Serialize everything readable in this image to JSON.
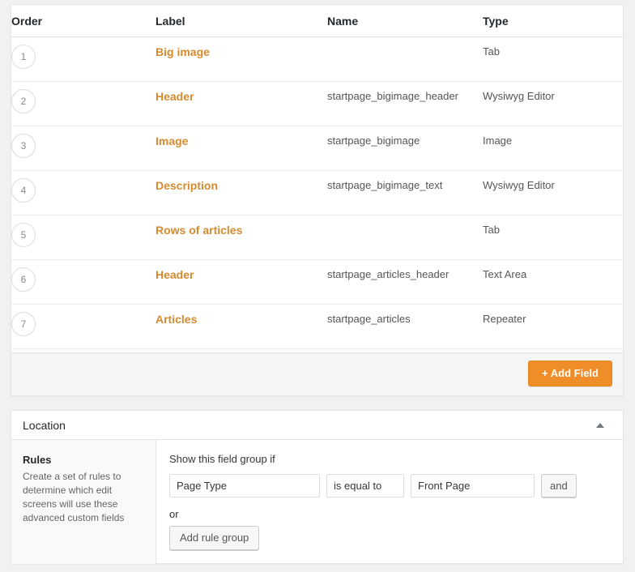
{
  "fields_table": {
    "columns": [
      "Order",
      "Label",
      "Name",
      "Type"
    ],
    "rows": [
      {
        "order": "1",
        "label": "Big image",
        "name": "",
        "type": "Tab",
        "group_start": false
      },
      {
        "order": "2",
        "label": "Header",
        "name": "startpage_bigimage_header",
        "type": "Wysiwyg Editor",
        "group_start": false
      },
      {
        "order": "3",
        "label": "Image",
        "name": "startpage_bigimage",
        "type": "Image",
        "group_start": false
      },
      {
        "order": "4",
        "label": "Description",
        "name": "startpage_bigimage_text",
        "type": "Wysiwyg Editor",
        "group_start": false
      },
      {
        "order": "5",
        "label": "Rows of articles",
        "name": "",
        "type": "Tab",
        "group_start": true
      },
      {
        "order": "6",
        "label": "Header",
        "name": "startpage_articles_header",
        "type": "Text Area",
        "group_start": false
      },
      {
        "order": "7",
        "label": "Articles",
        "name": "startpage_articles",
        "type": "Repeater",
        "group_start": false
      }
    ],
    "footer": {
      "add_field_label": "+ Add Field"
    }
  },
  "location_panel": {
    "title": "Location",
    "toggle_icon": "triangle-up-icon",
    "rules_sidebar": {
      "heading": "Rules",
      "description": "Create a set of rules to determine which edit screens will use these advanced custom fields"
    },
    "rules_main": {
      "intro": "Show this field group if",
      "rule": {
        "param": "Page Type",
        "operator": "is equal to",
        "value": "Front Page",
        "and_label": "and"
      },
      "or_label": "or",
      "add_rule_group_label": "Add rule group"
    }
  },
  "colors": {
    "accent_orange": "#ef8e28",
    "link_orange": "#d68a2e",
    "page_background": "#f1f1f1",
    "card_background": "#ffffff",
    "footer_background": "#f5f5f5"
  }
}
